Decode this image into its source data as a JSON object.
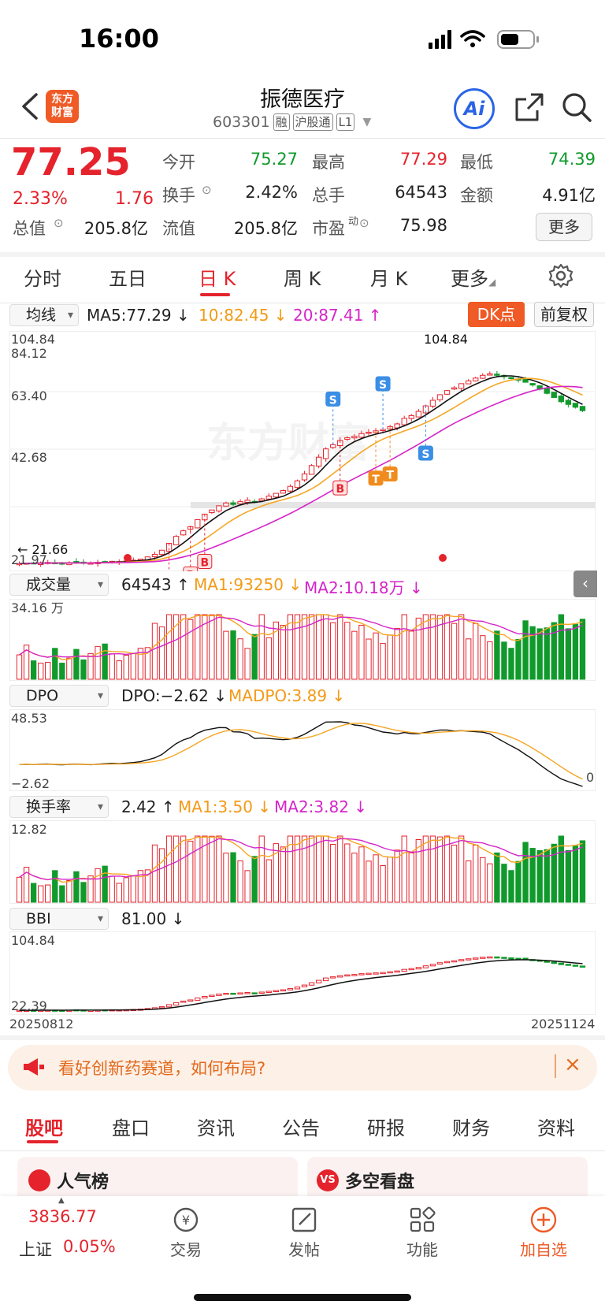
{
  "status_bar": {
    "time": "16:00"
  },
  "header": {
    "logo_text": [
      "东方",
      "财富"
    ],
    "title": "振德医疗",
    "code": "603301",
    "tags": [
      "融",
      "沪股通",
      "L1"
    ],
    "ai_label": "Ai"
  },
  "quote": {
    "price": "77.25",
    "change_pct": "2.33%",
    "change_val": "1.76",
    "fields": [
      {
        "label": "今开",
        "value": "75.27",
        "color": "green"
      },
      {
        "label": "最高",
        "value": "77.29",
        "color": "red"
      },
      {
        "label": "最低",
        "value": "74.39",
        "color": "green"
      },
      {
        "label": "换手",
        "value": "2.42%",
        "color": "plain"
      },
      {
        "label": "总手",
        "value": "64543",
        "color": "plain"
      },
      {
        "label": "金额",
        "value": "4.91亿",
        "color": "plain"
      },
      {
        "label": "总值",
        "value": "205.8亿",
        "color": "plain"
      },
      {
        "label": "流值",
        "value": "205.8亿",
        "color": "plain"
      },
      {
        "label": "市盈",
        "value": "75.98",
        "color": "plain"
      }
    ],
    "pe_superscript": "动",
    "more_label": "更多"
  },
  "period_tabs": [
    "分时",
    "五日",
    "日 K",
    "周 K",
    "月 K",
    "更多"
  ],
  "kline_panel": {
    "selector": "均线",
    "ma5": "MA5:77.29 ↓",
    "ma10": "10:82.45 ↓",
    "ma20": "20:87.41 ↑",
    "dk_label": "DK点",
    "adjust_label": "前复权",
    "y_ticks": [
      "104.84",
      "84.12",
      "63.40",
      "42.68",
      "21.97"
    ],
    "high_label": "104.84",
    "low_label": "← 21.66",
    "watermark": "东方财富"
  },
  "volume_panel": {
    "selector": "成交量",
    "value": "64543 ↑",
    "ma1": "MA1:93250 ↓",
    "ma2": "MA2:10.18万 ↓",
    "top_tick": "34.16 万"
  },
  "dpo_panel": {
    "selector": "DPO",
    "value": "DPO:−2.62 ↓",
    "madpo": "MADPO:3.89 ↓",
    "top_tick": "48.53",
    "bottom_tick": "−2.62",
    "right_tick": "0"
  },
  "turnover_panel": {
    "selector": "换手率",
    "value": "2.42 ↑",
    "ma1": "MA1:3.50 ↓",
    "ma2": "MA2:3.82 ↓",
    "top_tick": "12.82"
  },
  "bbi_panel": {
    "selector": "BBI",
    "value": "81.00 ↓",
    "top_tick": "104.84",
    "bottom_tick": "22.39",
    "date_start": "20250812",
    "date_end": "20251124"
  },
  "promo": {
    "text": "看好创新药赛道，如何布局?"
  },
  "bottom_tabs": [
    "股吧",
    "盘口",
    "资讯",
    "公告",
    "研报",
    "财务",
    "资料"
  ],
  "cards": [
    {
      "title": "人气榜"
    },
    {
      "title": "多空看盘"
    }
  ],
  "bottom_nav": {
    "index_value": "3836.77",
    "index_name": "上证",
    "index_change": "0.05%",
    "items": [
      "交易",
      "发帖",
      "功能",
      "加自选"
    ]
  },
  "colors": {
    "up": "#e5232c",
    "down": "#119a2c",
    "ma10": "#f5a623",
    "ma20": "#d525c9",
    "accent": "#ef5a26"
  },
  "chart_data": {
    "type": "candlestick",
    "x_range": [
      "20250812",
      "20251124"
    ],
    "ylim": [
      21.97,
      104.84
    ],
    "close": [
      22.2,
      22.4,
      22.3,
      22.5,
      22.6,
      22.4,
      22.3,
      22.5,
      22.6,
      22.5,
      22.4,
      22.6,
      22.8,
      23.0,
      22.9,
      23.1,
      23.4,
      23.8,
      24.6,
      25.5,
      27.0,
      29.5,
      32.0,
      34.0,
      35.5,
      38.0,
      40.0,
      41.5,
      43.0,
      44.0,
      43.5,
      44.5,
      45.0,
      44.2,
      45.5,
      46.5,
      47.5,
      48.5,
      50.0,
      52.0,
      54.5,
      57.5,
      60.5,
      63.5,
      65.0,
      66.5,
      67.5,
      68.0,
      69.0,
      69.5,
      70.0,
      70.5,
      71.5,
      72.5,
      74.5,
      75.5,
      77.0,
      79.0,
      81.0,
      83.0,
      84.5,
      85.5,
      87.0,
      88.0,
      89.0,
      90.0,
      90.5,
      90.0,
      89.5,
      89.0,
      88.5,
      87.5,
      86.5,
      85.0,
      83.5,
      82.0,
      80.5,
      79.5,
      78.5,
      77.25
    ],
    "volume_max_label": "34.16 万",
    "dpo_last": -2.62,
    "madpo_last": 3.89,
    "bbi_last": 81.0
  }
}
